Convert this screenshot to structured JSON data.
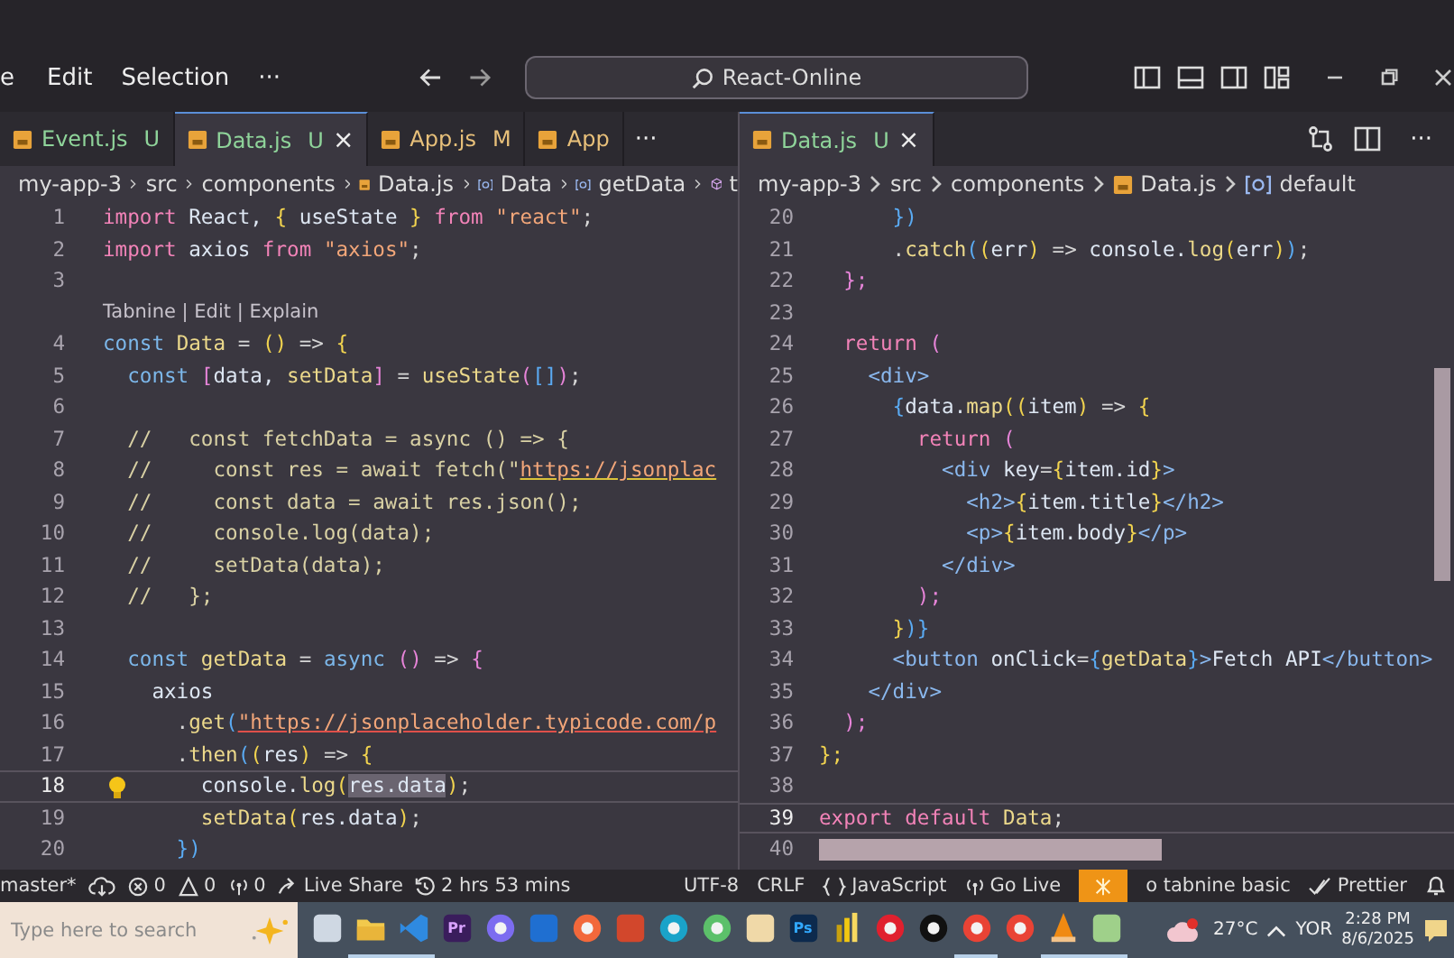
{
  "title_bar": {
    "menus": [
      "e",
      "Edit",
      "Selection"
    ],
    "more": "···",
    "search": "React-Online"
  },
  "panes": [
    {
      "tabs": [
        {
          "name": "Event.js",
          "badge": "U",
          "kind": "untracked",
          "selected": false
        },
        {
          "name": "Data.js",
          "badge": "U",
          "kind": "untracked",
          "selected": true,
          "close": "×"
        },
        {
          "name": "App.js",
          "badge": "M",
          "kind": "modified",
          "selected": false
        },
        {
          "name": "App",
          "kind": "plain",
          "selected": false
        }
      ],
      "tabs_more": "···",
      "breadcrumbs": [
        {
          "text": "my-app-3",
          "kind": "folder"
        },
        {
          "text": "src",
          "kind": "folder"
        },
        {
          "text": "components",
          "kind": "folder"
        },
        {
          "text": "Data.js",
          "kind": "file"
        },
        {
          "text": "Data",
          "kind": "symbol"
        },
        {
          "text": "getData",
          "kind": "symbol"
        },
        {
          "text": "t",
          "kind": "cube"
        }
      ],
      "lines": [
        {
          "kind": "code",
          "n": "1",
          "current": false,
          "hint": false,
          "marked": false,
          "code": [
            {
              "kind": "kw",
              "text": "import "
            },
            {
              "kind": "v",
              "text": "React, "
            },
            {
              "kind": "b1",
              "text": "{"
            },
            {
              "kind": "v",
              "text": " useState "
            },
            {
              "kind": "b1",
              "text": "} "
            },
            {
              "kind": "kw",
              "text": "from "
            },
            {
              "kind": "s",
              "text": "\"react\""
            },
            {
              "kind": "p",
              "text": ";"
            }
          ]
        },
        {
          "kind": "code",
          "n": "2",
          "current": false,
          "hint": false,
          "marked": false,
          "code": [
            {
              "kind": "kw",
              "text": "import "
            },
            {
              "kind": "v",
              "text": "axios "
            },
            {
              "kind": "kw",
              "text": "from "
            },
            {
              "kind": "s",
              "text": "\"axios\""
            },
            {
              "kind": "p",
              "text": ";"
            }
          ]
        },
        {
          "kind": "code",
          "n": "3",
          "current": false,
          "hint": false,
          "marked": false
        },
        {
          "kind": "lens",
          "text": "Tabnine | Edit | Explain"
        },
        {
          "kind": "code",
          "n": "4",
          "current": false,
          "hint": false,
          "marked": false,
          "code": [
            {
              "kind": "d",
              "text": "const "
            },
            {
              "kind": "fn",
              "text": "Data "
            },
            {
              "kind": "p",
              "text": "= "
            },
            {
              "kind": "b1",
              "text": "() "
            },
            {
              "kind": "p",
              "text": "=> "
            },
            {
              "kind": "b1",
              "text": "{"
            }
          ]
        },
        {
          "kind": "code",
          "n": "5",
          "current": false,
          "hint": false,
          "marked": false,
          "code": [
            {
              "kind": "d",
              "text": "  const "
            },
            {
              "kind": "b2",
              "text": "["
            },
            {
              "kind": "v",
              "text": "data, "
            },
            {
              "kind": "fn",
              "text": "setData"
            },
            {
              "kind": "b2",
              "text": "] "
            },
            {
              "kind": "p",
              "text": "= "
            },
            {
              "kind": "fn",
              "text": "useState"
            },
            {
              "kind": "b2",
              "text": "("
            },
            {
              "kind": "b3",
              "text": "[]"
            },
            {
              "kind": "b2",
              "text": ")"
            },
            {
              "kind": "p",
              "text": ";"
            }
          ]
        },
        {
          "kind": "code",
          "n": "6",
          "current": false,
          "hint": false,
          "marked": false
        },
        {
          "kind": "code",
          "n": "7",
          "current": false,
          "hint": false,
          "marked": false,
          "code": [
            {
              "kind": "c",
              "text": "  //   const fetchData = async () => {"
            }
          ]
        },
        {
          "kind": "code",
          "n": "8",
          "current": false,
          "hint": false,
          "marked": false,
          "code": [
            {
              "kind": "c",
              "text": "  //     const res = await fetch(\""
            },
            {
              "kind": "u",
              "text": "https://jsonplac"
            }
          ]
        },
        {
          "kind": "code",
          "n": "9",
          "current": false,
          "hint": false,
          "marked": false,
          "code": [
            {
              "kind": "c",
              "text": "  //     const data = await res.json();"
            }
          ]
        },
        {
          "kind": "code",
          "n": "10",
          "current": false,
          "hint": false,
          "marked": false,
          "code": [
            {
              "kind": "c",
              "text": "  //     console.log(data);"
            }
          ]
        },
        {
          "kind": "code",
          "n": "11",
          "current": false,
          "hint": false,
          "marked": false,
          "code": [
            {
              "kind": "c",
              "text": "  //     setData(data);"
            }
          ]
        },
        {
          "kind": "code",
          "n": "12",
          "current": false,
          "hint": false,
          "marked": false,
          "code": [
            {
              "kind": "c",
              "text": "  //   };"
            }
          ]
        },
        {
          "kind": "code",
          "n": "13",
          "current": false,
          "hint": false,
          "marked": false
        },
        {
          "kind": "code",
          "n": "14",
          "current": false,
          "hint": false,
          "marked": false,
          "code": [
            {
              "kind": "d",
              "text": "  const "
            },
            {
              "kind": "fn",
              "text": "getData "
            },
            {
              "kind": "p",
              "text": "= "
            },
            {
              "kind": "d",
              "text": "async "
            },
            {
              "kind": "b2",
              "text": "() "
            },
            {
              "kind": "p",
              "text": "=> "
            },
            {
              "kind": "b2",
              "text": "{"
            }
          ]
        },
        {
          "kind": "code",
          "n": "15",
          "current": false,
          "hint": false,
          "marked": false,
          "code": [
            {
              "kind": "v",
              "text": "    axios"
            }
          ]
        },
        {
          "kind": "code",
          "n": "16",
          "current": false,
          "hint": false,
          "marked": false,
          "code": [
            {
              "kind": "p",
              "text": "      ."
            },
            {
              "kind": "fn",
              "text": "get"
            },
            {
              "kind": "b3",
              "text": "("
            },
            {
              "kind": "e",
              "text": "\"https://jsonplaceholder.typicode.com/p"
            }
          ]
        },
        {
          "kind": "code",
          "n": "17",
          "current": false,
          "hint": false,
          "marked": false,
          "code": [
            {
              "kind": "p",
              "text": "      ."
            },
            {
              "kind": "fn",
              "text": "then"
            },
            {
              "kind": "b3",
              "text": "("
            },
            {
              "kind": "b1",
              "text": "("
            },
            {
              "kind": "v",
              "text": "res"
            },
            {
              "kind": "b1",
              "text": ") "
            },
            {
              "kind": "p",
              "text": "=> "
            },
            {
              "kind": "b1",
              "text": "{"
            }
          ]
        },
        {
          "kind": "code",
          "n": "18",
          "current": true,
          "hint": true,
          "marked": false,
          "code": [
            {
              "kind": "v",
              "text": "        console."
            },
            {
              "kind": "fn",
              "text": "log"
            },
            {
              "kind": "b1",
              "text": "("
            },
            {
              "kind": "sel",
              "text": "res.data"
            },
            {
              "kind": "b1",
              "text": ")"
            },
            {
              "kind": "p",
              "text": ";"
            }
          ]
        },
        {
          "kind": "code",
          "n": "19",
          "current": false,
          "hint": false,
          "marked": false,
          "code": [
            {
              "kind": "fn",
              "text": "        setData"
            },
            {
              "kind": "b1",
              "text": "("
            },
            {
              "kind": "v",
              "text": "res.data"
            },
            {
              "kind": "b1",
              "text": ")"
            },
            {
              "kind": "p",
              "text": ";"
            }
          ]
        },
        {
          "kind": "code",
          "n": "20",
          "current": false,
          "hint": false,
          "marked": false,
          "code": [
            {
              "kind": "b3",
              "text": "      })"
            }
          ]
        }
      ]
    },
    {
      "tabs": [
        {
          "name": "Data.js",
          "badge": "U",
          "kind": "untracked",
          "selected": true,
          "close": "×"
        }
      ],
      "actions_more": "···",
      "breadcrumbs": [
        {
          "text": "my-app-3",
          "kind": "folder"
        },
        {
          "text": "src",
          "kind": "folder"
        },
        {
          "text": "components",
          "kind": "folder"
        },
        {
          "text": "Data.js",
          "kind": "file"
        },
        {
          "text": "default",
          "kind": "symbol"
        }
      ],
      "lines": [
        {
          "kind": "code",
          "n": "20",
          "current": false,
          "hint": false,
          "marked": false,
          "code": [
            {
              "kind": "b3",
              "text": "      })"
            }
          ]
        },
        {
          "kind": "code",
          "n": "21",
          "current": false,
          "hint": false,
          "marked": false,
          "code": [
            {
              "kind": "p",
              "text": "      ."
            },
            {
              "kind": "fn",
              "text": "catch"
            },
            {
              "kind": "b3",
              "text": "("
            },
            {
              "kind": "b1",
              "text": "("
            },
            {
              "kind": "v",
              "text": "err"
            },
            {
              "kind": "b1",
              "text": ") "
            },
            {
              "kind": "p",
              "text": "=> "
            },
            {
              "kind": "v",
              "text": "console."
            },
            {
              "kind": "fn",
              "text": "log"
            },
            {
              "kind": "b1",
              "text": "("
            },
            {
              "kind": "v",
              "text": "err"
            },
            {
              "kind": "b1",
              "text": ")"
            },
            {
              "kind": "b3",
              "text": ")"
            },
            {
              "kind": "p",
              "text": ";"
            }
          ]
        },
        {
          "kind": "code",
          "n": "22",
          "current": false,
          "hint": false,
          "marked": false,
          "code": [
            {
              "kind": "b2",
              "text": "  };"
            }
          ]
        },
        {
          "kind": "code",
          "n": "23",
          "current": false,
          "hint": false,
          "marked": false
        },
        {
          "kind": "code",
          "n": "24",
          "current": false,
          "hint": false,
          "marked": false,
          "code": [
            {
              "kind": "kw",
              "text": "  return "
            },
            {
              "kind": "b2",
              "text": "("
            }
          ]
        },
        {
          "kind": "code",
          "n": "25",
          "current": false,
          "hint": false,
          "marked": false,
          "code": [
            {
              "kind": "tag",
              "text": "    <div>"
            }
          ]
        },
        {
          "kind": "code",
          "n": "26",
          "current": false,
          "hint": false,
          "marked": false,
          "code": [
            {
              "kind": "b3",
              "text": "      {"
            },
            {
              "kind": "v",
              "text": "data."
            },
            {
              "kind": "fn",
              "text": "map"
            },
            {
              "kind": "b1",
              "text": "(("
            },
            {
              "kind": "v",
              "text": "item"
            },
            {
              "kind": "b1",
              "text": ") "
            },
            {
              "kind": "p",
              "text": "=> "
            },
            {
              "kind": "b1",
              "text": "{"
            }
          ]
        },
        {
          "kind": "code",
          "n": "27",
          "current": false,
          "hint": false,
          "marked": false,
          "code": [
            {
              "kind": "kw",
              "text": "        return "
            },
            {
              "kind": "b2",
              "text": "("
            }
          ]
        },
        {
          "kind": "code",
          "n": "28",
          "current": false,
          "hint": false,
          "marked": false,
          "code": [
            {
              "kind": "tag",
              "text": "          <div "
            },
            {
              "kind": "v",
              "text": "key"
            },
            {
              "kind": "p",
              "text": "="
            },
            {
              "kind": "b1",
              "text": "{"
            },
            {
              "kind": "v",
              "text": "item.id"
            },
            {
              "kind": "b1",
              "text": "}"
            },
            {
              "kind": "tag",
              "text": ">"
            }
          ]
        },
        {
          "kind": "code",
          "n": "29",
          "current": false,
          "hint": false,
          "marked": false,
          "code": [
            {
              "kind": "tag",
              "text": "            <h2>"
            },
            {
              "kind": "b1",
              "text": "{"
            },
            {
              "kind": "v",
              "text": "item.title"
            },
            {
              "kind": "b1",
              "text": "}"
            },
            {
              "kind": "tag",
              "text": "</h2>"
            }
          ]
        },
        {
          "kind": "code",
          "n": "30",
          "current": false,
          "hint": false,
          "marked": false,
          "code": [
            {
              "kind": "tag",
              "text": "            <p>"
            },
            {
              "kind": "b1",
              "text": "{"
            },
            {
              "kind": "v",
              "text": "item.body"
            },
            {
              "kind": "b1",
              "text": "}"
            },
            {
              "kind": "tag",
              "text": "</p>"
            }
          ]
        },
        {
          "kind": "code",
          "n": "31",
          "current": false,
          "hint": false,
          "marked": false,
          "code": [
            {
              "kind": "tag",
              "text": "          </div>"
            }
          ]
        },
        {
          "kind": "code",
          "n": "32",
          "current": false,
          "hint": false,
          "marked": false,
          "code": [
            {
              "kind": "b2",
              "text": "        );"
            }
          ]
        },
        {
          "kind": "code",
          "n": "33",
          "current": false,
          "hint": false,
          "marked": false,
          "code": [
            {
              "kind": "b1",
              "text": "      }"
            },
            {
              "kind": "b3",
              "text": ")}"
            }
          ]
        },
        {
          "kind": "code",
          "n": "34",
          "current": false,
          "hint": false,
          "marked": false,
          "code": [
            {
              "kind": "tag",
              "text": "      <button "
            },
            {
              "kind": "v",
              "text": "onClick"
            },
            {
              "kind": "p",
              "text": "="
            },
            {
              "kind": "b3",
              "text": "{"
            },
            {
              "kind": "fn",
              "text": "getData"
            },
            {
              "kind": "b3",
              "text": "}"
            },
            {
              "kind": "tag",
              "text": ">"
            },
            {
              "kind": "v",
              "text": "Fetch API"
            },
            {
              "kind": "tag",
              "text": "</button>"
            }
          ]
        },
        {
          "kind": "code",
          "n": "35",
          "current": false,
          "hint": false,
          "marked": false,
          "code": [
            {
              "kind": "tag",
              "text": "    </div>"
            }
          ]
        },
        {
          "kind": "code",
          "n": "36",
          "current": false,
          "hint": false,
          "marked": false,
          "code": [
            {
              "kind": "b2",
              "text": "  );"
            }
          ]
        },
        {
          "kind": "code",
          "n": "37",
          "current": false,
          "hint": false,
          "marked": false,
          "code": [
            {
              "kind": "b1",
              "text": "};"
            }
          ]
        },
        {
          "kind": "code",
          "n": "38",
          "current": false,
          "hint": false,
          "marked": false
        },
        {
          "kind": "code",
          "n": "39",
          "current": true,
          "hint": false,
          "marked": false,
          "code": [
            {
              "kind": "kw",
              "text": "export default "
            },
            {
              "kind": "fn",
              "text": "Data"
            },
            {
              "kind": "p",
              "text": ";"
            }
          ]
        },
        {
          "kind": "code",
          "n": "40",
          "current": false,
          "hint": false,
          "marked": true
        }
      ]
    }
  ],
  "status_bar": {
    "left": [
      {
        "kind": "branch",
        "text": "master*"
      },
      {
        "kind": "sync"
      },
      {
        "kind": "errors",
        "text": "0"
      },
      {
        "kind": "warnings",
        "text": "0"
      },
      {
        "kind": "ports",
        "text": "0"
      },
      {
        "kind": "liveshare",
        "text": "Live Share"
      },
      {
        "kind": "history",
        "text": "2 hrs 53 mins"
      }
    ],
    "right": [
      {
        "kind": "text",
        "text": "UTF-8"
      },
      {
        "kind": "text",
        "text": "CRLF"
      },
      {
        "kind": "language",
        "text": "JavaScript"
      },
      {
        "kind": "golive",
        "text": "Go Live"
      },
      {
        "kind": "tabnine"
      },
      {
        "kind": "text",
        "text": "o tabnine basic"
      },
      {
        "kind": "prettier",
        "text": "Prettier"
      },
      {
        "kind": "bell"
      }
    ]
  },
  "taskbar": {
    "search": {
      "placeholder": "Type here to search"
    },
    "apps": [
      {
        "kind": "taskview",
        "running": false
      },
      {
        "kind": "folder",
        "running": true
      },
      {
        "kind": "vscode",
        "running": true
      },
      {
        "kind": "pr",
        "label": "Pr",
        "running": false
      },
      {
        "kind": "copilot",
        "running": false
      },
      {
        "kind": "outlook",
        "running": false
      },
      {
        "kind": "firefox",
        "running": false
      },
      {
        "kind": "powerpoint",
        "running": false
      },
      {
        "kind": "edge",
        "running": false
      },
      {
        "kind": "green",
        "running": false
      },
      {
        "kind": "store",
        "running": false
      },
      {
        "kind": "ps",
        "label": "Ps",
        "running": false
      },
      {
        "kind": "powerbi",
        "running": false
      },
      {
        "kind": "opera",
        "running": false
      },
      {
        "kind": "tiktok",
        "running": false
      },
      {
        "kind": "chrome",
        "running": true
      },
      {
        "kind": "chrome",
        "running": false
      },
      {
        "kind": "vlc",
        "running": true
      },
      {
        "kind": "notepad",
        "running": true
      }
    ],
    "weather": "27°C",
    "language": "YOR",
    "time": "2:28 PM",
    "date": "8/6/2025"
  }
}
